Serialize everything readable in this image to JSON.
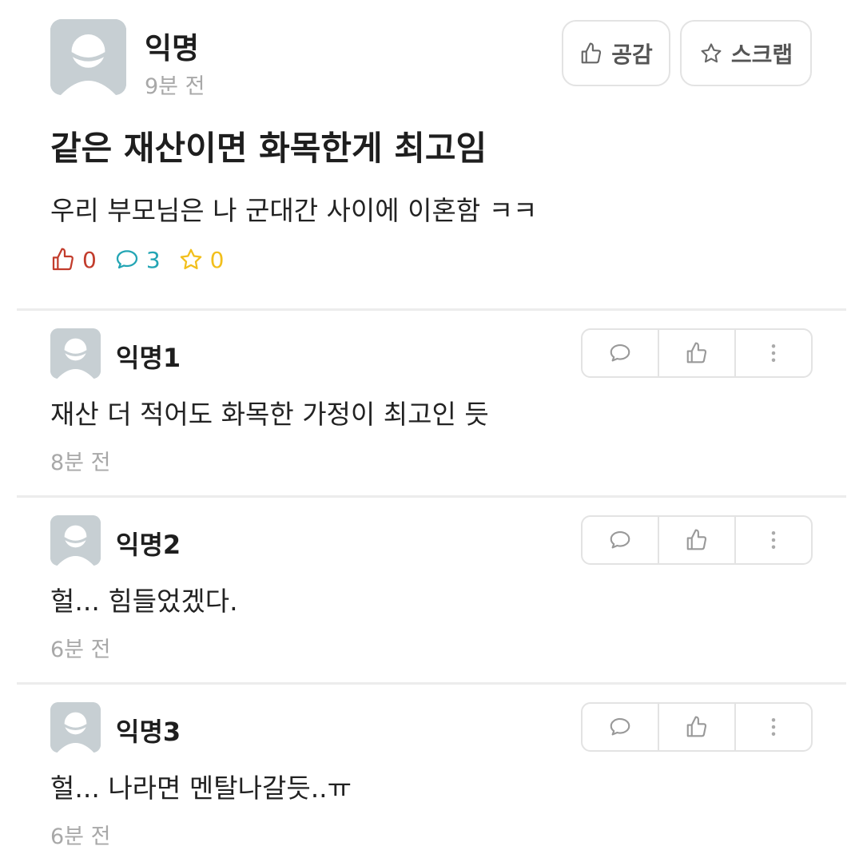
{
  "post": {
    "author": "익명",
    "time": "9분 전",
    "like_button_label": "공감",
    "scrap_button_label": "스크랩",
    "title": "같은 재산이면 화목한게 최고임",
    "body": "우리 부모님은 나 군대간 사이에 이혼함 ㅋㅋ",
    "stats": {
      "likes": "0",
      "comments": "3",
      "scraps": "0"
    },
    "colors": {
      "like": "#c23c2c",
      "comment": "#23a5b4",
      "scrap": "#f2bf1c"
    }
  },
  "comments": [
    {
      "author": "익명1",
      "text": "재산 더 적어도 화목한 가정이 최고인 듯",
      "time": "8분 전"
    },
    {
      "author": "익명2",
      "text": "헐... 힘들었겠다.",
      "time": "6분 전"
    },
    {
      "author": "익명3",
      "text": "헐... 나라면 멘탈나갈듯..ㅠ",
      "time": "6분 전"
    }
  ],
  "icons": {
    "avatar": "default-avatar-icon",
    "like": "thumbs-up-icon",
    "scrap": "star-icon",
    "comment": "speech-bubble-icon",
    "more": "more-vertical-icon"
  }
}
